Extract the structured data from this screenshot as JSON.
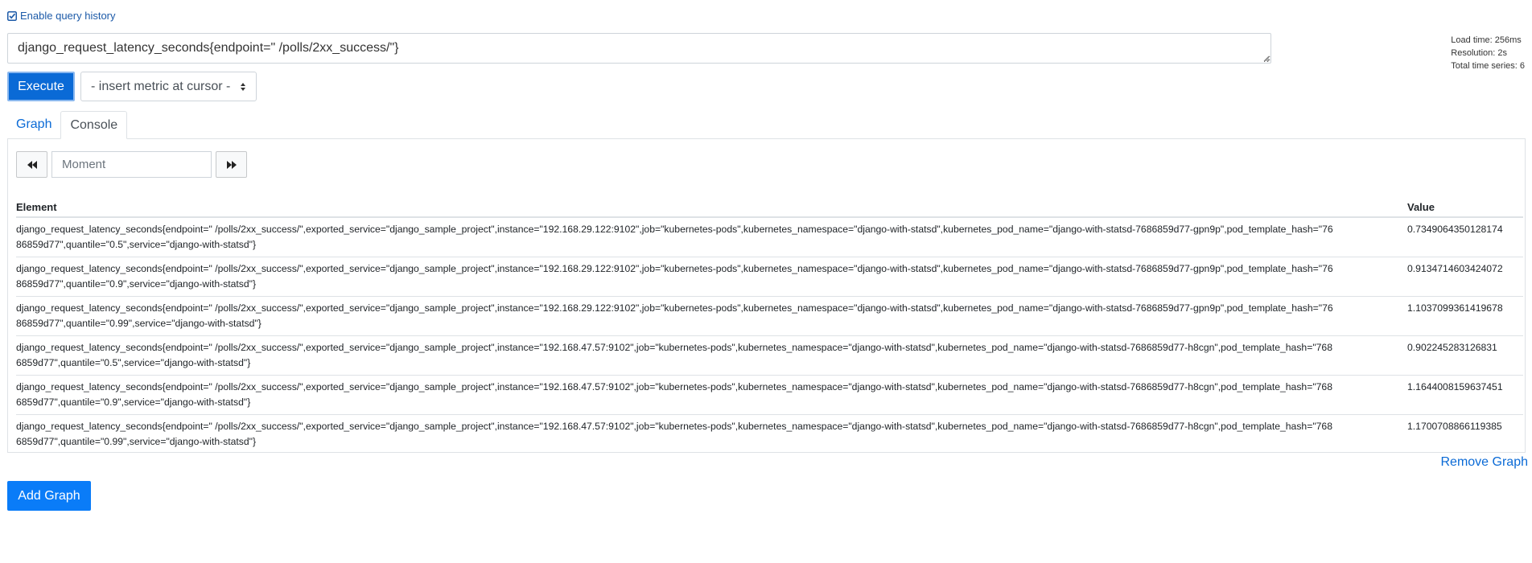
{
  "query_history": {
    "label": "Enable query history",
    "icon": "check-square-icon"
  },
  "query": {
    "value": "django_request_latency_seconds{endpoint=\" /polls/2xx_success/\"}"
  },
  "stats": {
    "load_time": "Load time: 256ms",
    "resolution": "Resolution: 2s",
    "total_series": "Total time series: 6"
  },
  "toolbar": {
    "execute_label": "Execute",
    "metric_select": "- insert metric at cursor -"
  },
  "tabs": [
    {
      "label": "Graph",
      "active": false
    },
    {
      "label": "Console",
      "active": true
    }
  ],
  "time_controls": {
    "moment_placeholder": "Moment",
    "back_icon": "fast-backward-icon",
    "forward_icon": "fast-forward-icon"
  },
  "table": {
    "headers": {
      "element": "Element",
      "value": "Value"
    },
    "rows": [
      {
        "element": "django_request_latency_seconds{endpoint=\" /polls/2xx_success/\",exported_service=\"django_sample_project\",instance=\"192.168.29.122:9102\",job=\"kubernetes-pods\",kubernetes_namespace=\"django-with-statsd\",kubernetes_pod_name=\"django-with-statsd-7686859d77-gpn9p\",pod_template_hash=\"7686859d77\",quantile=\"0.5\",service=\"django-with-statsd\"}",
        "value": "0.7349064350128174"
      },
      {
        "element": "django_request_latency_seconds{endpoint=\" /polls/2xx_success/\",exported_service=\"django_sample_project\",instance=\"192.168.29.122:9102\",job=\"kubernetes-pods\",kubernetes_namespace=\"django-with-statsd\",kubernetes_pod_name=\"django-with-statsd-7686859d77-gpn9p\",pod_template_hash=\"7686859d77\",quantile=\"0.9\",service=\"django-with-statsd\"}",
        "value": "0.9134714603424072"
      },
      {
        "element": "django_request_latency_seconds{endpoint=\" /polls/2xx_success/\",exported_service=\"django_sample_project\",instance=\"192.168.29.122:9102\",job=\"kubernetes-pods\",kubernetes_namespace=\"django-with-statsd\",kubernetes_pod_name=\"django-with-statsd-7686859d77-gpn9p\",pod_template_hash=\"7686859d77\",quantile=\"0.99\",service=\"django-with-statsd\"}",
        "value": "1.1037099361419678"
      },
      {
        "element": "django_request_latency_seconds{endpoint=\" /polls/2xx_success/\",exported_service=\"django_sample_project\",instance=\"192.168.47.57:9102\",job=\"kubernetes-pods\",kubernetes_namespace=\"django-with-statsd\",kubernetes_pod_name=\"django-with-statsd-7686859d77-h8cgn\",pod_template_hash=\"7686859d77\",quantile=\"0.5\",service=\"django-with-statsd\"}",
        "value": "0.902245283126831"
      },
      {
        "element": "django_request_latency_seconds{endpoint=\" /polls/2xx_success/\",exported_service=\"django_sample_project\",instance=\"192.168.47.57:9102\",job=\"kubernetes-pods\",kubernetes_namespace=\"django-with-statsd\",kubernetes_pod_name=\"django-with-statsd-7686859d77-h8cgn\",pod_template_hash=\"7686859d77\",quantile=\"0.9\",service=\"django-with-statsd\"}",
        "value": "1.1644008159637451"
      },
      {
        "element": "django_request_latency_seconds{endpoint=\" /polls/2xx_success/\",exported_service=\"django_sample_project\",instance=\"192.168.47.57:9102\",job=\"kubernetes-pods\",kubernetes_namespace=\"django-with-statsd\",kubernetes_pod_name=\"django-with-statsd-7686859d77-h8cgn\",pod_template_hash=\"7686859d77\",quantile=\"0.99\",service=\"django-with-statsd\"}",
        "value": "1.1700708866119385"
      }
    ]
  },
  "actions": {
    "remove_graph": "Remove Graph",
    "add_graph": "Add Graph"
  },
  "colors": {
    "link": "#0a6ad6",
    "execute_bg": "#0a6ad6",
    "add_graph_bg": "#0a7cf8",
    "border": "#dee2e6"
  }
}
